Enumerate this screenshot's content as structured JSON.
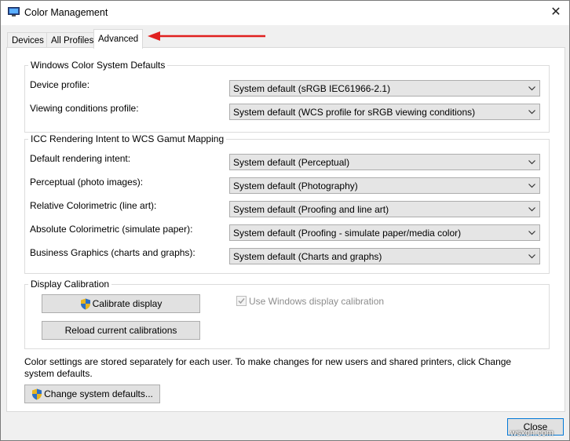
{
  "window": {
    "title": "Color Management",
    "close_glyph": "✕"
  },
  "tabs": [
    {
      "label": "Devices"
    },
    {
      "label": "All Profiles"
    },
    {
      "label": "Advanced",
      "active": true
    }
  ],
  "wcs_defaults": {
    "title": "Windows Color System Defaults",
    "rows": [
      {
        "label": "Device profile:",
        "value": "System default (sRGB IEC61966-2.1)"
      },
      {
        "label": "Viewing conditions profile:",
        "value": "System default (WCS profile for sRGB viewing conditions)"
      }
    ]
  },
  "icc_mapping": {
    "title": "ICC Rendering Intent to WCS Gamut Mapping",
    "rows": [
      {
        "label": "Default rendering intent:",
        "value": "System default (Perceptual)"
      },
      {
        "label": "Perceptual (photo images):",
        "value": "System default (Photography)"
      },
      {
        "label": "Relative Colorimetric (line art):",
        "value": "System default (Proofing and line art)"
      },
      {
        "label": "Absolute Colorimetric (simulate paper):",
        "value": "System default (Proofing - simulate paper/media color)"
      },
      {
        "label": "Business Graphics (charts and graphs):",
        "value": "System default (Charts and graphs)"
      }
    ]
  },
  "calibration": {
    "title": "Display Calibration",
    "calibrate_label": "Calibrate display",
    "reload_label": "Reload current calibrations",
    "use_windows_label": "Use Windows display calibration",
    "use_windows_checked": true,
    "use_windows_enabled": false
  },
  "note": "Color settings are stored separately for each user. To make changes for new users and shared printers, click Change system defaults.",
  "change_defaults_label": "Change system defaults...",
  "close_label": "Close",
  "watermark": "wsxdn.com",
  "colors": {
    "annotation_arrow": "#e0201f",
    "focus_border": "#0078d7",
    "shield_blue": "#2b6fc7",
    "shield_gold": "#e8b420"
  }
}
